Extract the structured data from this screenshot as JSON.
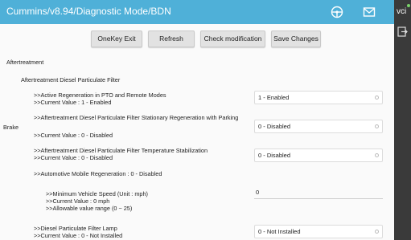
{
  "titlebar": {
    "title": "Cummins/v8.94/Diagnostic Mode/BDN",
    "icons": [
      "steering-wheel-icon",
      "mail-icon"
    ]
  },
  "rightbar": {
    "vci_label": "vci"
  },
  "toolbar": {
    "onekey_exit": "OneKey Exit",
    "refresh": "Refresh",
    "check_modification": "Check modification",
    "save_changes": "Save Changes"
  },
  "section": {
    "title": "Aftertreatment",
    "subtitle": "Aftertreatment Diesel Particulate Filter"
  },
  "params": [
    {
      "name": ">>Active Regeneration in PTO and Remote Modes",
      "current": ">>Current Value : 1 - Enabled",
      "selected": "1 - Enabled"
    },
    {
      "name": ">>Aftertreatment Diesel Particulate Filter Stationary Regeneration with Parking",
      "name_wrap": "Brake",
      "current": ">>Current Value : 0 - Disabled",
      "selected": "0 - Disabled"
    },
    {
      "name": ">>Aftertreatment Diesel Particulate Filter Temperature Stabilization",
      "current": ">>Current Value : 0 - Disabled",
      "selected": "0 - Disabled"
    },
    {
      "name": ">>Automotive Mobile Regeneration : 0 - Disabled"
    },
    {
      "name": ">>Minimum Vehicle Speed  (Unit : mph)",
      "current": ">>Current Value : 0 mph",
      "range": ">>Allowable value range (0 ~ 25)",
      "value": "0"
    },
    {
      "name": ">>Diesel Particulate Filter Lamp",
      "current": ">>Current Value : 0 - Not Installed",
      "selected": "0 - Not Installed"
    }
  ],
  "colors": {
    "titlebar": "#4fb0d8",
    "background": "#fafafa",
    "button": "#e2e2e2"
  }
}
